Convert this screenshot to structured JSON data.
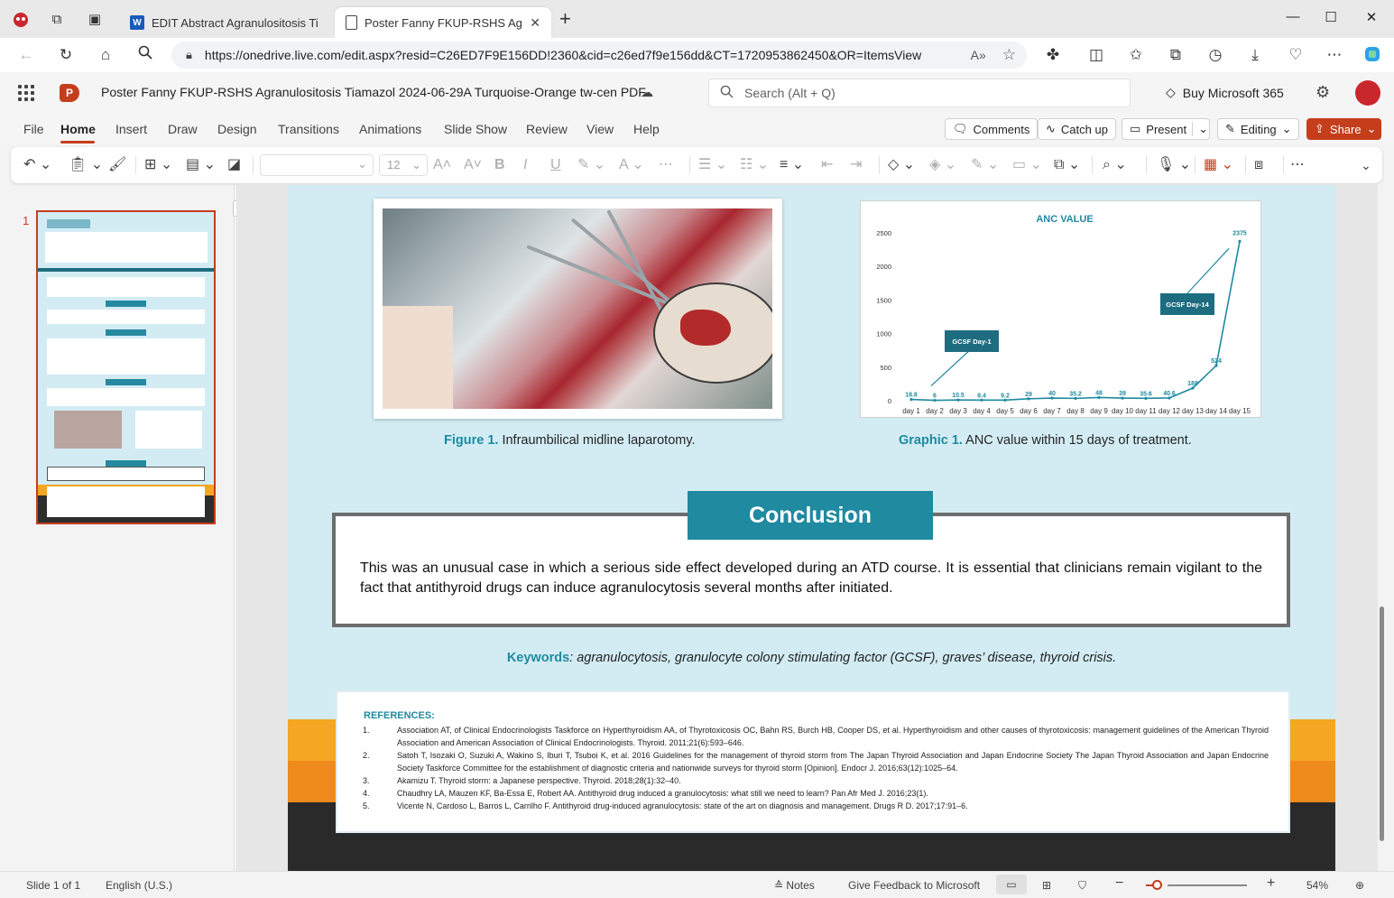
{
  "browser": {
    "tabs": [
      {
        "title": "EDIT Abstract Agranulositosis Tia",
        "icon": "word-icon",
        "active": false
      },
      {
        "title": "Poster Fanny FKUP-RSHS Agranu",
        "icon": "document-icon",
        "active": true
      }
    ],
    "url": "https://onedrive.live.com/edit.aspx?resid=C26ED7F9E156DD!2360&cid=c26ed7f9e156dd&CT=1720953862450&OR=ItemsView"
  },
  "office": {
    "app_logo": "P",
    "doc_title": "Poster Fanny FKUP-RSHS Agranulositosis Tiamazol 2024-06-29A Turquoise-Orange tw-cen PDF",
    "search_placeholder": "Search (Alt + Q)",
    "buy_label": "Buy Microsoft 365"
  },
  "menu": {
    "items": [
      "File",
      "Home",
      "Insert",
      "Draw",
      "Design",
      "Transitions",
      "Animations",
      "Slide Show",
      "Review",
      "View",
      "Help"
    ],
    "selected": "Home",
    "comments_label": "Comments",
    "catchup_label": "Catch up",
    "present_label": "Present",
    "editing_label": "Editing",
    "share_label": "Share"
  },
  "ribbon": {
    "font_size": "12"
  },
  "thumbnails": {
    "slide_number": "1"
  },
  "slide": {
    "figure_caption_label": "Figure 1.",
    "figure_caption_text": " Infraumbilical midline laparotomy.",
    "graphic_caption_label": "Graphic 1.",
    "graphic_caption_text": " ANC value within 15 days of treatment.",
    "conclusion_heading": "Conclusion",
    "conclusion_text": "This was an unusual case in which a serious side effect developed during an ATD course. It is essential that clinicians remain vigilant to the fact that antithyroid drugs can induce agranulocytosis several months after initiated.",
    "keywords_label": "Keywords",
    "keywords_text": ": agranulocytosis, granulocyte colony stimulating factor (GCSF), graves’ disease, thyroid crisis.",
    "references_title": "REFERENCES:",
    "references": [
      {
        "num": "1.",
        "text": "Association AT, of Clinical Endocrinologists Taskforce on Hyperthyroidism AA, of Thyrotoxicosis OC, Bahn RS, Burch HB, Cooper DS, et al. Hyperthyroidism and other causes of thyrotoxicosis: management guidelines of the American Thyroid Association and American Association of Clinical Endocrinologists. Thyroid. 2011;21(6):593–646."
      },
      {
        "num": "2.",
        "text": "Satoh T, Isozaki O, Suzuki A, Wakino S, Iburi T, Tsuboi K, et al. 2016 Guidelines for the management of thyroid storm from The Japan Thyroid Association and Japan Endocrine Society The Japan Thyroid Association and Japan Endocrine Society Taskforce Committee for the establishment of diagnostic criteria and nationwide surveys for thyroid storm [Opinion]. Endocr J. 2016;63(12):1025–64."
      },
      {
        "num": "3.",
        "text": "Akamizu T. Thyroid storm: a Japanese perspective. Thyroid. 2018;28(1):32–40."
      },
      {
        "num": "4.",
        "text": "Chaudhry LA, Mauzen KF, Ba-Essa E, Robert AA. Antithyroid drug induced a granulocytosis: what still we need to learn? Pan Afr Med J. 2016;23(1)."
      },
      {
        "num": "5.",
        "text": "Vicente N, Cardoso L, Barros L, Carrilho F. Antithyroid drug-induced agranulocytosis: state of the art on diagnosis and management. Drugs R D. 2017;17:91–6."
      }
    ]
  },
  "chart_data": {
    "type": "line",
    "title": "ANC VALUE",
    "categories": [
      "day 1",
      "day 2",
      "day 3",
      "day 4",
      "day 5",
      "day 6",
      "day 7",
      "day 8",
      "day 9",
      "day 10",
      "day 11",
      "day 12",
      "day 13",
      "day 14",
      "day 15"
    ],
    "values": [
      18.8,
      6,
      10.5,
      9.4,
      9.2,
      29,
      40,
      35.2,
      48,
      39,
      35.6,
      40.6,
      188,
      524,
      2375
    ],
    "value_labels": [
      "18.8",
      "6",
      "10.5",
      "9.4",
      "9.2",
      "29",
      "40",
      "35.2",
      "48",
      "39",
      "35.6",
      "40.6",
      "188",
      "524",
      "2375"
    ],
    "yticks": [
      0,
      500,
      1000,
      1500,
      2000,
      2500
    ],
    "ylim": [
      0,
      2500
    ],
    "color": "#1f8aa0",
    "annotations": [
      {
        "text": "GCSF Day-1",
        "day_index": 1
      },
      {
        "text": "GCSF Day-14",
        "day_index": 13
      }
    ]
  },
  "status": {
    "slide_info": "Slide 1 of 1",
    "language": "English (U.S.)",
    "notes_label": "Notes",
    "feedback_label": "Give Feedback to Microsoft",
    "zoom_level": "54%"
  }
}
